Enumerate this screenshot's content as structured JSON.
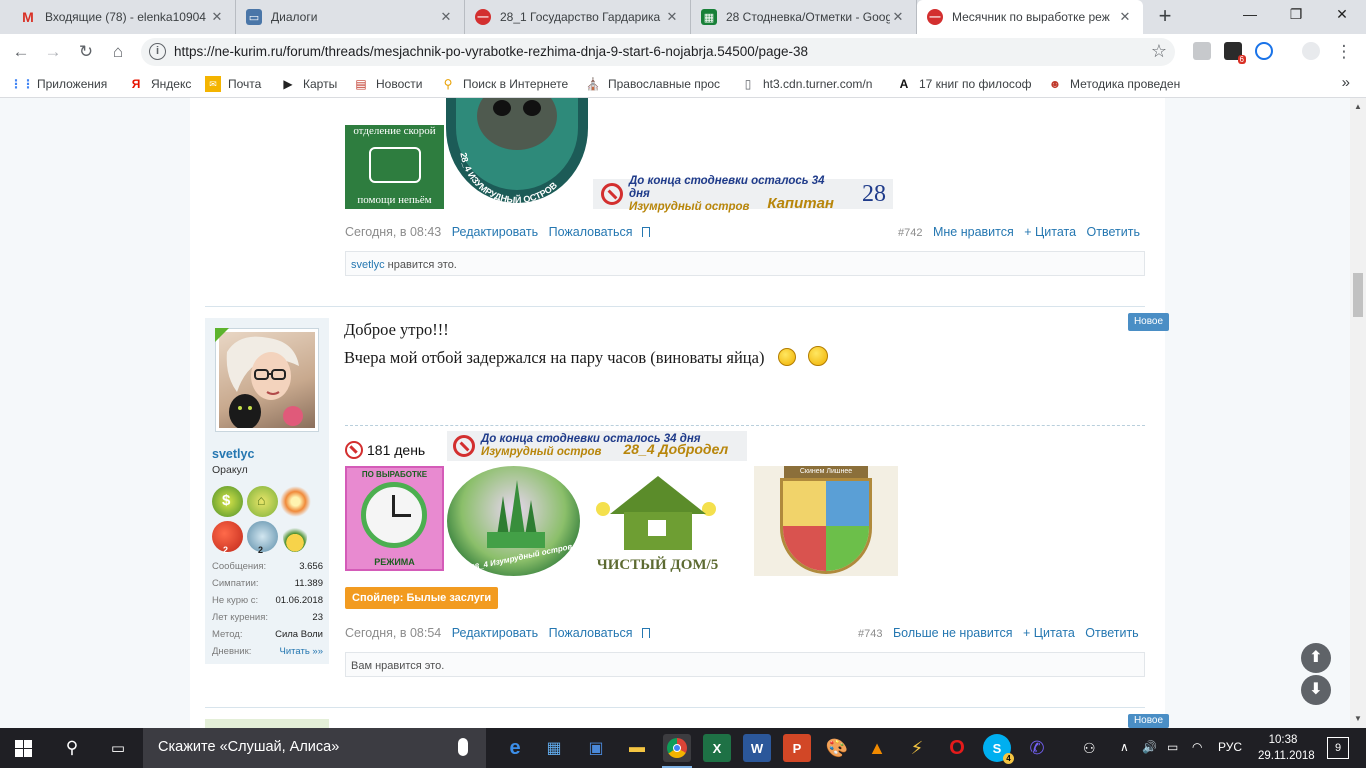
{
  "tabs": [
    {
      "title": "Входящие (78) - elenka10904",
      "icon": "gmail-icon",
      "color": "#d93025"
    },
    {
      "title": "Диалоги",
      "icon": "vk-dialogs-icon",
      "color": "#4a76a8"
    },
    {
      "title": "28_1 Государство Гардарика |",
      "icon": "no-smoking-icon",
      "color": "#d32f2f"
    },
    {
      "title": "28 Стодневка/Отметки - Goog",
      "icon": "sheets-icon",
      "color": "#188038"
    },
    {
      "title": "Месячник по выработке реж",
      "icon": "no-smoking-icon",
      "color": "#d32f2f",
      "active": true
    }
  ],
  "address": {
    "url": "https://ne-kurim.ru/forum/threads/mesjachnik-po-vyrabotke-rezhima-dnja-9-start-6-nojabrja.54500/page-38"
  },
  "extensions": {
    "badge_count": "6"
  },
  "bookmarks": [
    {
      "label": "Приложения",
      "icon": "apps-grid-icon",
      "color": "#4285f4"
    },
    {
      "label": "Яндекс",
      "icon": "yandex-icon",
      "color": "#e61400"
    },
    {
      "label": "Почта",
      "icon": "mail-icon",
      "color": "#f4b400"
    },
    {
      "label": "Карты",
      "icon": "maps-icon",
      "color": "#222222"
    },
    {
      "label": "Новости",
      "icon": "news-icon",
      "color": "#c0392b"
    },
    {
      "label": "Поиск в Интернете",
      "icon": "search-web-icon",
      "color": "#e8a000"
    },
    {
      "label": "Православные прос",
      "icon": "church-icon",
      "color": "#1f6fb5"
    },
    {
      "label": "ht3.cdn.turner.com/n",
      "icon": "page-icon",
      "color": "#5f6368"
    },
    {
      "label": "17 книг по философ",
      "icon": "book-icon",
      "color": "#111111"
    },
    {
      "label": "Методика проведен",
      "icon": "method-icon",
      "color": "#c0392b"
    }
  ],
  "post1": {
    "badge_top": "отделение скорой",
    "badge_bottom": "помощи непьём",
    "skull_caption": "28_4 ИЗУМРУДНЫЙ ОСТРОВ",
    "counter_line1": "До конца стодневки осталось 34 дня",
    "counter_line2": "Изумрудный остров",
    "counter_rank": "Капитан",
    "counter_num": "28",
    "date": "Сегодня, в 08:43",
    "edit": "Редактировать",
    "report": "Пожаловаться",
    "number": "#742",
    "like": "Мне нравится",
    "quote": "+ Цитата",
    "reply": "Ответить",
    "liked_user": "svetlyc",
    "liked_text": " нравится это."
  },
  "post2": {
    "new_badge": "Новое",
    "line1": "Доброе утро!!!",
    "line2": "Вчера мой отбой задержался на пару часов (виноваты яйца)",
    "days": "181 день",
    "counter_line1": "До конца стодневки осталось 34 дня",
    "counter_line2": "Изумрудный остров",
    "counter_rank": "28_4  Добродел",
    "img1_top": "ПО ВЫРАБОТКЕ",
    "img1_bottom": "РЕЖИМА",
    "img2_caption": "#28_4 Изумрудный остров",
    "img3_caption": "ЧИСТЫЙ ДОМ/5",
    "img4_banner": "Скинем Лишнее",
    "spoiler": "Спойлер: Былые заслуги",
    "date": "Сегодня, в 08:54",
    "edit": "Редактировать",
    "report": "Пожаловаться",
    "number": "#743",
    "unlike": "Больше не нравится",
    "quote": "+ Цитата",
    "reply": "Ответить",
    "liked_text": "Вам нравится это."
  },
  "user": {
    "name": "svetlyc",
    "title": "Оракул",
    "trophy_counts": [
      "2",
      "2"
    ],
    "stats": [
      {
        "k": "Сообщения:",
        "v": "3.656"
      },
      {
        "k": "Симпатии:",
        "v": "11.389"
      },
      {
        "k": "Не курю с:",
        "v": "01.06.2018"
      },
      {
        "k": "Лет курения:",
        "v": "23"
      },
      {
        "k": "Метод:",
        "v": "Сила Воли"
      },
      {
        "k": "Дневник:",
        "v": "Читать »»"
      }
    ]
  },
  "post3": {
    "new_badge": "Новое"
  },
  "taskbar": {
    "search_placeholder": "Скажите «Слушай, Алиса»",
    "lang": "РУС",
    "time": "10:38",
    "date": "29.11.2018",
    "notifications": "9",
    "skype_badge": "4"
  }
}
